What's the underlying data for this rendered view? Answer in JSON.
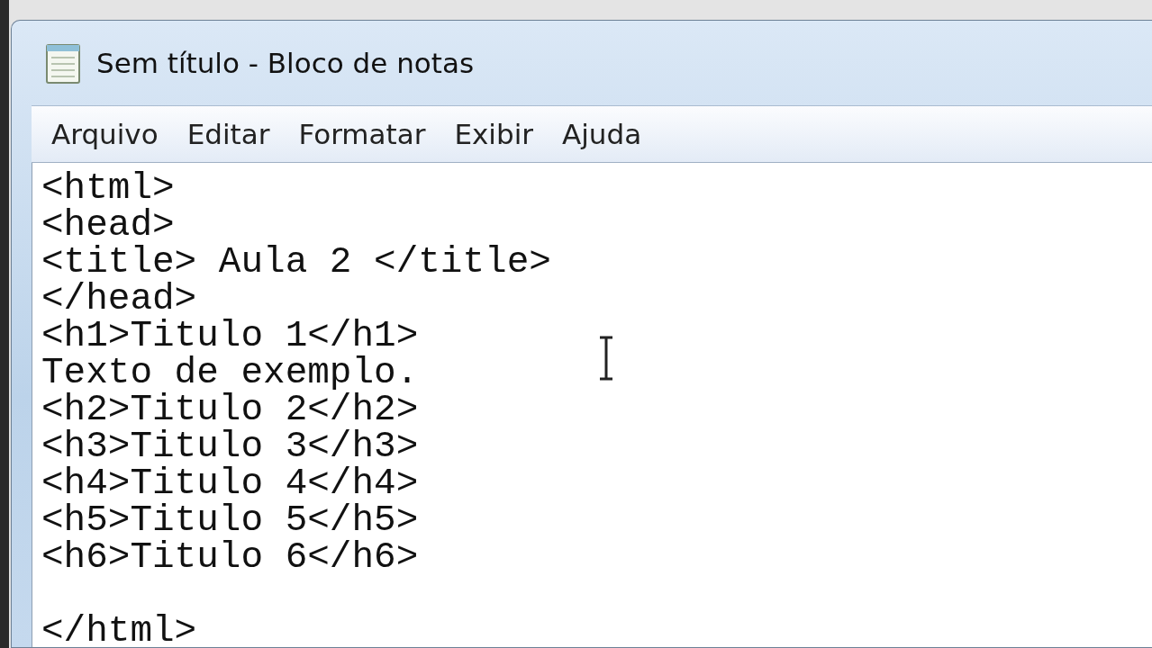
{
  "window": {
    "title": "Sem título - Bloco de notas"
  },
  "menu": [
    {
      "label": "Arquivo"
    },
    {
      "label": "Editar"
    },
    {
      "label": "Formatar"
    },
    {
      "label": "Exibir"
    },
    {
      "label": "Ajuda"
    }
  ],
  "editor": {
    "text": "<html>\n<head>\n<title> Aula 2 </title>\n</head>\n<h1>Titulo 1</h1>\nTexto de exemplo.\n<h2>Titulo 2</h2>\n<h3>Titulo 3</h3>\n<h4>Titulo 4</h4>\n<h5>Titulo 5</h5>\n<h6>Titulo 6</h6>\n\n</html>"
  }
}
